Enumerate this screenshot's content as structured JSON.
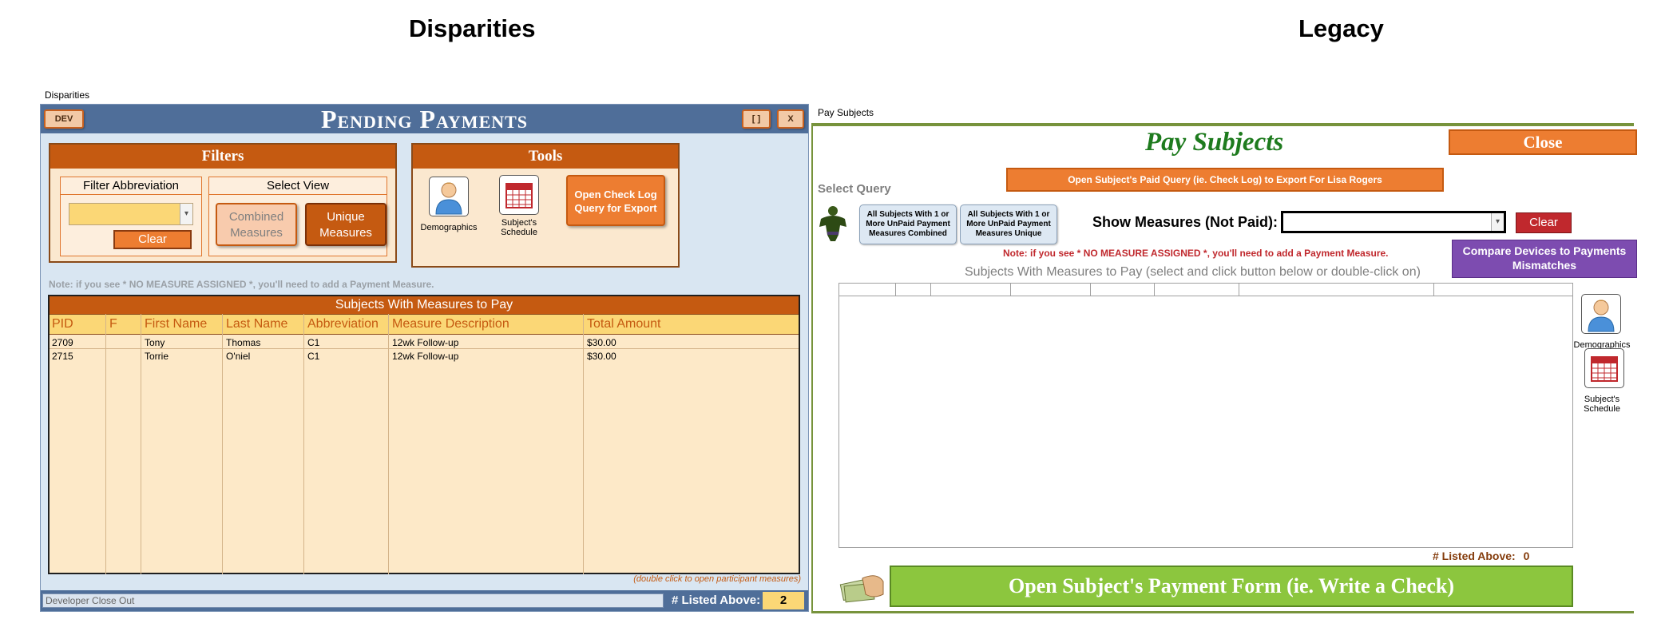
{
  "headers": {
    "left": "Disparities",
    "right": "Legacy"
  },
  "left": {
    "window_caption": "Disparities",
    "title": "Pending Payments",
    "dev_label": "DEV",
    "restore_label": "[ ]",
    "close_label": "X",
    "filters": {
      "heading": "Filters",
      "filter_abbrev_label": "Filter Abbreviation",
      "filter_value": "",
      "clear_label": "Clear",
      "select_view_label": "Select View",
      "combined_label": "Combined Measures",
      "unique_label": "Unique Measures"
    },
    "tools": {
      "heading": "Tools",
      "demographics_label": "Demographics",
      "schedule_label": "Subject's Schedule",
      "open_checklog_label": "Open Check Log Query for Export"
    },
    "note": "Note: if you see * NO MEASURE ASSIGNED *, you'll need to add a Payment Measure.",
    "table": {
      "title": "Subjects With Measures to Pay",
      "columns": [
        "PID",
        "F",
        "First Name",
        "Last Name",
        "Abbreviation",
        "Measure Description",
        "Total Amount"
      ],
      "rows": [
        [
          "2709",
          "",
          "Tony",
          "Thomas",
          "C1",
          "12wk Follow-up",
          "$30.00"
        ],
        [
          "2715",
          "",
          "Torrie",
          "O'niel",
          "C1",
          "12wk Follow-up",
          "$30.00"
        ]
      ]
    },
    "dblclick_note": "(double click to open participant measures)",
    "footer": {
      "dev_closeout": "Developer Close Out",
      "listed_label": "# Listed Above:",
      "listed_value": "2"
    }
  },
  "right": {
    "window_caption": "Pay Subjects",
    "title": "Pay Subjects",
    "close_label": "Close",
    "open_paid_label": "Open Subject's Paid Query (ie. Check Log) to Export For Lisa Rogers",
    "select_query_label": "Select Query",
    "query_combined_label": "All Subjects With 1 or More UnPaid Payment Measures Combined",
    "query_unique_label": "All Subjects With 1 or More UnPaid Payment Measures Unique",
    "show_measures_label": "Show Measures (Not Paid):",
    "show_measures_value": "",
    "clear_label": "Clear",
    "note": "Note: if you see * NO MEASURE ASSIGNED *, you'll need to add a Payment Measure.",
    "compare_label": "Compare Devices to Payments Mismatches",
    "subjects_header": "Subjects With Measures to Pay (select and click button below or double-click on)",
    "demographics_label": "Demographics",
    "schedule_label": "Subject's Schedule",
    "listed_label": "# Listed Above:",
    "listed_value": "0",
    "payment_form_label": "Open Subject's Payment Form (ie. Write a Check)"
  }
}
